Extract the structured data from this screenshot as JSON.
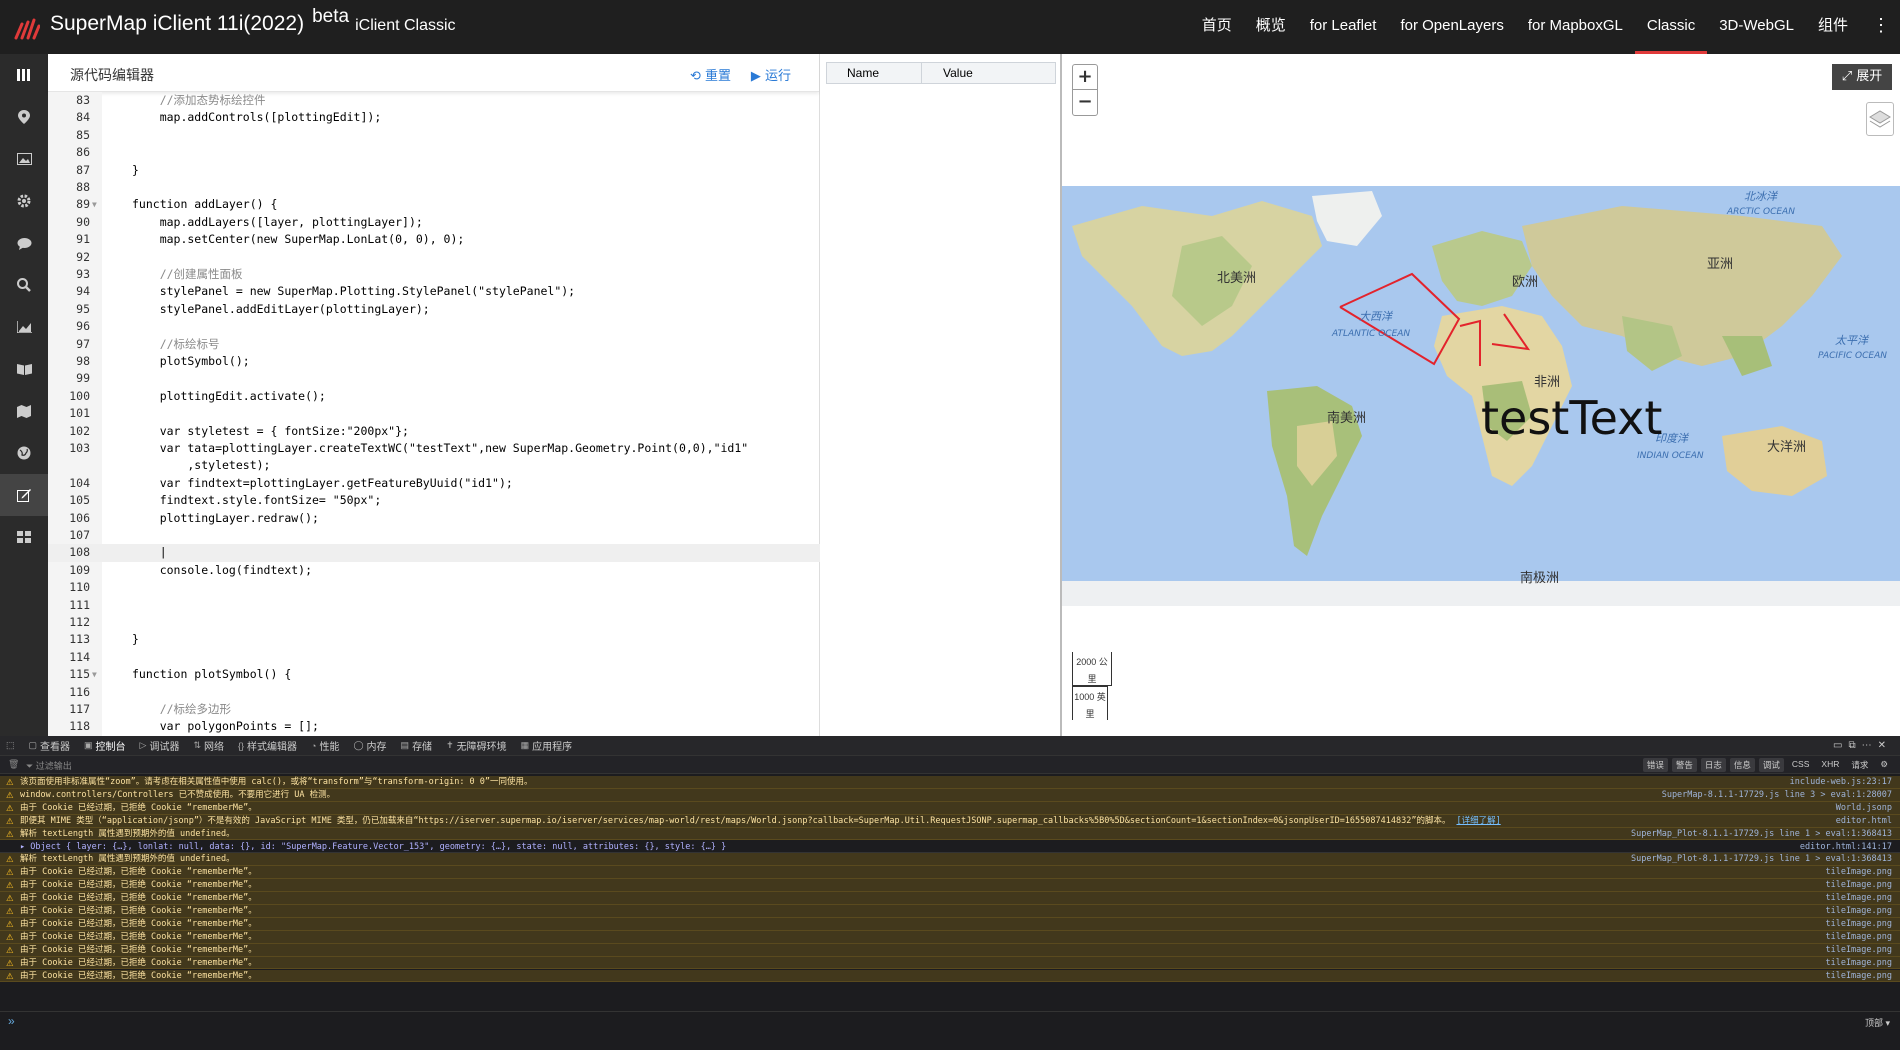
{
  "header": {
    "brand": "SuperMap iClient 11i(2022)",
    "beta": "beta",
    "subtitle": "iClient Classic",
    "nav": [
      "首页",
      "概览",
      "for Leaflet",
      "for OpenLayers",
      "for MapboxGL",
      "Classic",
      "3D-WebGL",
      "组件"
    ],
    "active_nav": "Classic",
    "accent": "#e03a3a"
  },
  "sidebar": {
    "icons": [
      "menu-icon",
      "location-icon",
      "image-icon",
      "gear-icon",
      "chat-icon",
      "search-icon",
      "chart-icon",
      "book-icon",
      "map-icon",
      "globe-icon",
      "edit-icon",
      "grid-icon"
    ],
    "active_index": 10
  },
  "editor": {
    "title": "源代码编辑器",
    "reset_label": "重置",
    "run_label": "运行",
    "lines": [
      {
        "n": "83",
        "t": "    //添加态势标绘控件",
        "fold": false
      },
      {
        "n": "84",
        "t": "    map.addControls([plottingEdit]);",
        "fold": false
      },
      {
        "n": "85",
        "t": "",
        "fold": false
      },
      {
        "n": "86",
        "t": "",
        "fold": false
      },
      {
        "n": "87",
        "t": "}",
        "fold": false
      },
      {
        "n": "88",
        "t": "",
        "fold": false
      },
      {
        "n": "89",
        "t": "function addLayer() {",
        "fold": true
      },
      {
        "n": "90",
        "t": "    map.addLayers([layer, plottingLayer]);",
        "fold": false
      },
      {
        "n": "91",
        "t": "    map.setCenter(new SuperMap.LonLat(0, 0), 0);",
        "fold": false
      },
      {
        "n": "92",
        "t": "",
        "fold": false
      },
      {
        "n": "93",
        "t": "    //创建属性面板",
        "fold": false
      },
      {
        "n": "94",
        "t": "    stylePanel = new SuperMap.Plotting.StylePanel(\"stylePanel\");",
        "fold": false
      },
      {
        "n": "95",
        "t": "    stylePanel.addEditLayer(plottingLayer);",
        "fold": false
      },
      {
        "n": "96",
        "t": "",
        "fold": false
      },
      {
        "n": "97",
        "t": "    //标绘标号",
        "fold": false
      },
      {
        "n": "98",
        "t": "    plotSymbol();",
        "fold": false
      },
      {
        "n": "99",
        "t": "",
        "fold": false
      },
      {
        "n": "100",
        "t": "    plottingEdit.activate();",
        "fold": false
      },
      {
        "n": "101",
        "t": "",
        "fold": false
      },
      {
        "n": "102",
        "t": "    var styletest = { fontSize:\"200px\"};",
        "fold": false
      },
      {
        "n": "103",
        "t": "    var tata=plottingLayer.createTextWC(\"testText\",new SuperMap.Geometry.Point(0,0),\"id1\"",
        "fold": false
      },
      {
        "n": "",
        "t": "        ,styletest);",
        "fold": false
      },
      {
        "n": "104",
        "t": "    var findtext=plottingLayer.getFeatureByUuid(\"id1\");",
        "fold": false
      },
      {
        "n": "105",
        "t": "    findtext.style.fontSize= \"50px\";",
        "fold": false
      },
      {
        "n": "106",
        "t": "    plottingLayer.redraw();",
        "fold": false
      },
      {
        "n": "107",
        "t": "",
        "fold": false
      },
      {
        "n": "108",
        "t": "    |",
        "fold": false
      },
      {
        "n": "109",
        "t": "    console.log(findtext);",
        "fold": false
      },
      {
        "n": "110",
        "t": "",
        "fold": false
      },
      {
        "n": "111",
        "t": "",
        "fold": false
      },
      {
        "n": "112",
        "t": "",
        "fold": false
      },
      {
        "n": "113",
        "t": "}",
        "fold": false
      },
      {
        "n": "114",
        "t": "",
        "fold": false
      },
      {
        "n": "115",
        "t": "function plotSymbol() {",
        "fold": true
      },
      {
        "n": "116",
        "t": "",
        "fold": false
      },
      {
        "n": "117",
        "t": "    //标绘多边形",
        "fold": false
      },
      {
        "n": "118",
        "t": "    var polygonPoints = [];",
        "fold": false
      }
    ],
    "highlight_line": 26
  },
  "props": {
    "col_name": "Name",
    "col_value": "Value"
  },
  "map": {
    "zoom_in": "+",
    "zoom_out": "−",
    "expand_label": "展开",
    "labels": {
      "north_america": "北美洲",
      "south_america": "南美洲",
      "europe": "欧洲",
      "asia": "亚洲",
      "africa": "非洲",
      "oceania": "大洋洲",
      "antarctica": "南极洲",
      "atlantic_cn": "大西洋",
      "atlantic_en": "ATLANTIC OCEAN",
      "pacific_cn": "太平洋",
      "pacific_en": "PACIFIC OCEAN",
      "indian_cn": "印度洋",
      "indian_en": "INDIAN OCEAN",
      "arctic_cn": "北冰洋",
      "arctic_en": "ARCTIC OCEAN"
    },
    "feature_text": "testText",
    "scale_top": "2000 公里",
    "scale_bottom": "1000 英里",
    "polygon_color": "#e3232c"
  },
  "devtools": {
    "tabs": [
      "查看器",
      "控制台",
      "调试器",
      "网络",
      "样式编辑器",
      "性能",
      "内存",
      "存储",
      "无障碍环境",
      "应用程序"
    ],
    "active_tab": "控制台",
    "filter_placeholder": "过滤输出",
    "chips": [
      "错误",
      "警告",
      "日志",
      "信息",
      "调试",
      "CSS",
      "XHR",
      "请求"
    ],
    "messages": [
      {
        "type": "warn",
        "text": "该页面使用非标准属性“zoom”。请考虑在相关属性值中使用 calc()，或将“transform”与“transform-origin: 0 0”一同使用。",
        "src": "include-web.js:23:17"
      },
      {
        "type": "warn",
        "text": "window.controllers/Controllers 已不赞成使用。不要用它进行 UA 检测。",
        "src": "SuperMap-8.1.1-17729.js line 3 > eval:1:28007"
      },
      {
        "type": "warn",
        "text": "由于 Cookie 已经过期，已拒绝 Cookie “rememberMe”。",
        "src": "World.jsonp"
      },
      {
        "type": "warn",
        "text": "即便其 MIME 类型（“application/jsonp”）不是有效的 JavaScript MIME 类型，仍已加载来自“https://iserver.supermap.io/iserver/services/map-world/rest/maps/World.jsonp?callback=SuperMap.Util.RequestJSONP.supermap_callbacks%5B0%5D&sectionCount=1&sectionIndex=0&jsonpUserID=1655087414832”的脚本。",
        "link": "[详细了解]",
        "src": "editor.html"
      },
      {
        "type": "warn",
        "text": "解析 textLength 属性遇到预期外的值 undefined。",
        "src": "SuperMap_Plot-8.1.1-17729.js line 1 > eval:1:368413"
      },
      {
        "type": "log",
        "text": "▸ Object { layer: {…}, lonlat: null, data: {}, id: \"SuperMap.Feature.Vector_153\", geometry: {…}, state: null, attributes: {}, style: {…} }",
        "src": "editor.html:141:17"
      },
      {
        "type": "warn",
        "text": "解析 textLength 属性遇到预期外的值 undefined。",
        "src": "SuperMap_Plot-8.1.1-17729.js line 1 > eval:1:368413"
      },
      {
        "type": "warn",
        "text": "由于 Cookie 已经过期，已拒绝 Cookie “rememberMe”。",
        "src": "tileImage.png"
      },
      {
        "type": "warn",
        "text": "由于 Cookie 已经过期，已拒绝 Cookie “rememberMe”。",
        "src": "tileImage.png"
      },
      {
        "type": "warn",
        "text": "由于 Cookie 已经过期，已拒绝 Cookie “rememberMe”。",
        "src": "tileImage.png"
      },
      {
        "type": "warn",
        "text": "由于 Cookie 已经过期，已拒绝 Cookie “rememberMe”。",
        "src": "tileImage.png"
      },
      {
        "type": "warn",
        "text": "由于 Cookie 已经过期，已拒绝 Cookie “rememberMe”。",
        "src": "tileImage.png"
      },
      {
        "type": "warn",
        "text": "由于 Cookie 已经过期，已拒绝 Cookie “rememberMe”。",
        "src": "tileImage.png"
      },
      {
        "type": "warn",
        "text": "由于 Cookie 已经过期，已拒绝 Cookie “rememberMe”。",
        "src": "tileImage.png"
      },
      {
        "type": "warn",
        "text": "由于 Cookie 已经过期，已拒绝 Cookie “rememberMe”。",
        "src": "tileImage.png"
      },
      {
        "type": "warn",
        "text": "由于 Cookie 已经过期，已拒绝 Cookie “rememberMe”。",
        "src": "tileImage.png"
      }
    ],
    "bottom_right": "顶部 ▾"
  }
}
